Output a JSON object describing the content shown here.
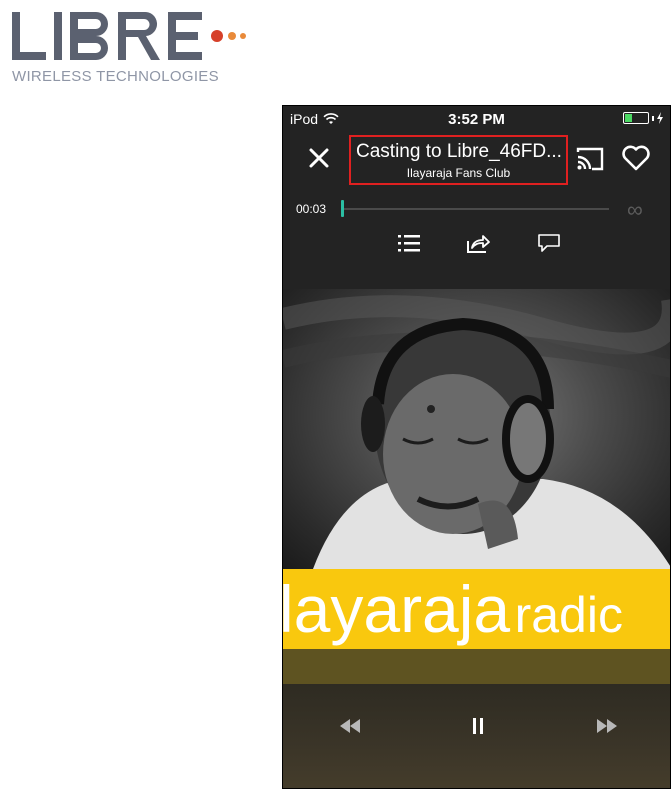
{
  "logo": {
    "wordmark": "LIBRE",
    "tagline": "WIRELESS TECHNOLOGIES",
    "colors": {
      "wordmark": "#5b6170",
      "tagline": "#8f96a6",
      "dot_primary": "#d6402a",
      "dot_secondary": "#e98a3a"
    }
  },
  "status_bar": {
    "carrier": "iPod",
    "time": "3:52 PM",
    "battery_level": 0.3,
    "charging": true
  },
  "header": {
    "close_icon": "close-icon",
    "title": "Casting to Libre_46FD...",
    "subtitle": "Ilayaraja Fans Club",
    "cast_icon": "cast-icon",
    "favorite_icon": "heart-icon",
    "highlight_color": "#e02020"
  },
  "playback": {
    "elapsed": "00:03",
    "progress": 0.0,
    "duration_symbol": "∞",
    "accent_color": "#2bbfa4"
  },
  "actions": [
    {
      "name": "queue-list-icon"
    },
    {
      "name": "share-icon"
    },
    {
      "name": "comment-icon"
    }
  ],
  "artwork": {
    "banner_text_large": "layaraja",
    "banner_text_small": "radic",
    "banner_color": "#f9c80e"
  },
  "controls": [
    {
      "name": "rewind-icon"
    },
    {
      "name": "pause-icon"
    },
    {
      "name": "fast-forward-icon"
    }
  ]
}
